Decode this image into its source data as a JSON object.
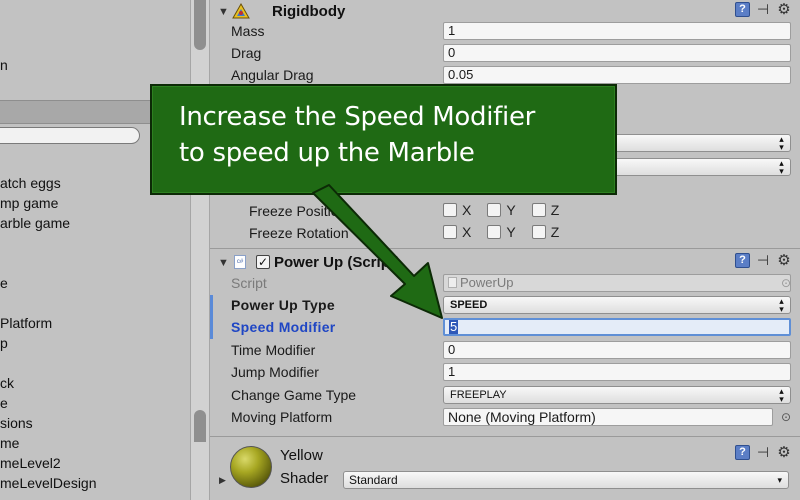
{
  "hierarchy": {
    "fragments_top": [
      "",
      "n"
    ],
    "fragments": [
      "atch eggs",
      "mp game",
      "arble game",
      "e",
      "Platform",
      "p",
      "ck",
      "e",
      "sions",
      "me",
      "meLevel2",
      "meLevelDesign"
    ]
  },
  "rigidbody": {
    "title": "Rigidbody",
    "mass": {
      "label": "Mass",
      "value": "1"
    },
    "drag": {
      "label": "Drag",
      "value": "0"
    },
    "angular_drag": {
      "label": "Angular Drag",
      "value": "0.05"
    },
    "freeze_position": {
      "label": "Freeze Position",
      "x": "X",
      "y": "Y",
      "z": "Z"
    },
    "freeze_rotation": {
      "label": "Freeze Rotation",
      "x": "X",
      "y": "Y",
      "z": "Z"
    }
  },
  "powerup": {
    "title": "Power Up (Script)",
    "script": {
      "label": "Script",
      "value": "PowerUp"
    },
    "power_up_type": {
      "label": "Power Up Type",
      "value": "SPEED"
    },
    "speed_modifier": {
      "label": "Speed Modifier",
      "value": "5"
    },
    "time_modifier": {
      "label": "Time Modifier",
      "value": "0"
    },
    "jump_modifier": {
      "label": "Jump Modifier",
      "value": "1"
    },
    "change_game_type": {
      "label": "Change Game Type",
      "value": "FREEPLAY"
    },
    "moving_platform": {
      "label": "Moving Platform",
      "value": "None (Moving Platform)"
    }
  },
  "material": {
    "name": "Yellow",
    "shader_label": "Shader",
    "shader_value": "Standard"
  },
  "callout": {
    "line1": "Increase the Speed Modifier",
    "line2": "to speed up the Marble",
    "color": "#1f6a14"
  },
  "icons": [
    "help-icon",
    "preset-icon",
    "gear-icon",
    "rigidbody-icon",
    "script-icon",
    "object-picker-icon"
  ]
}
